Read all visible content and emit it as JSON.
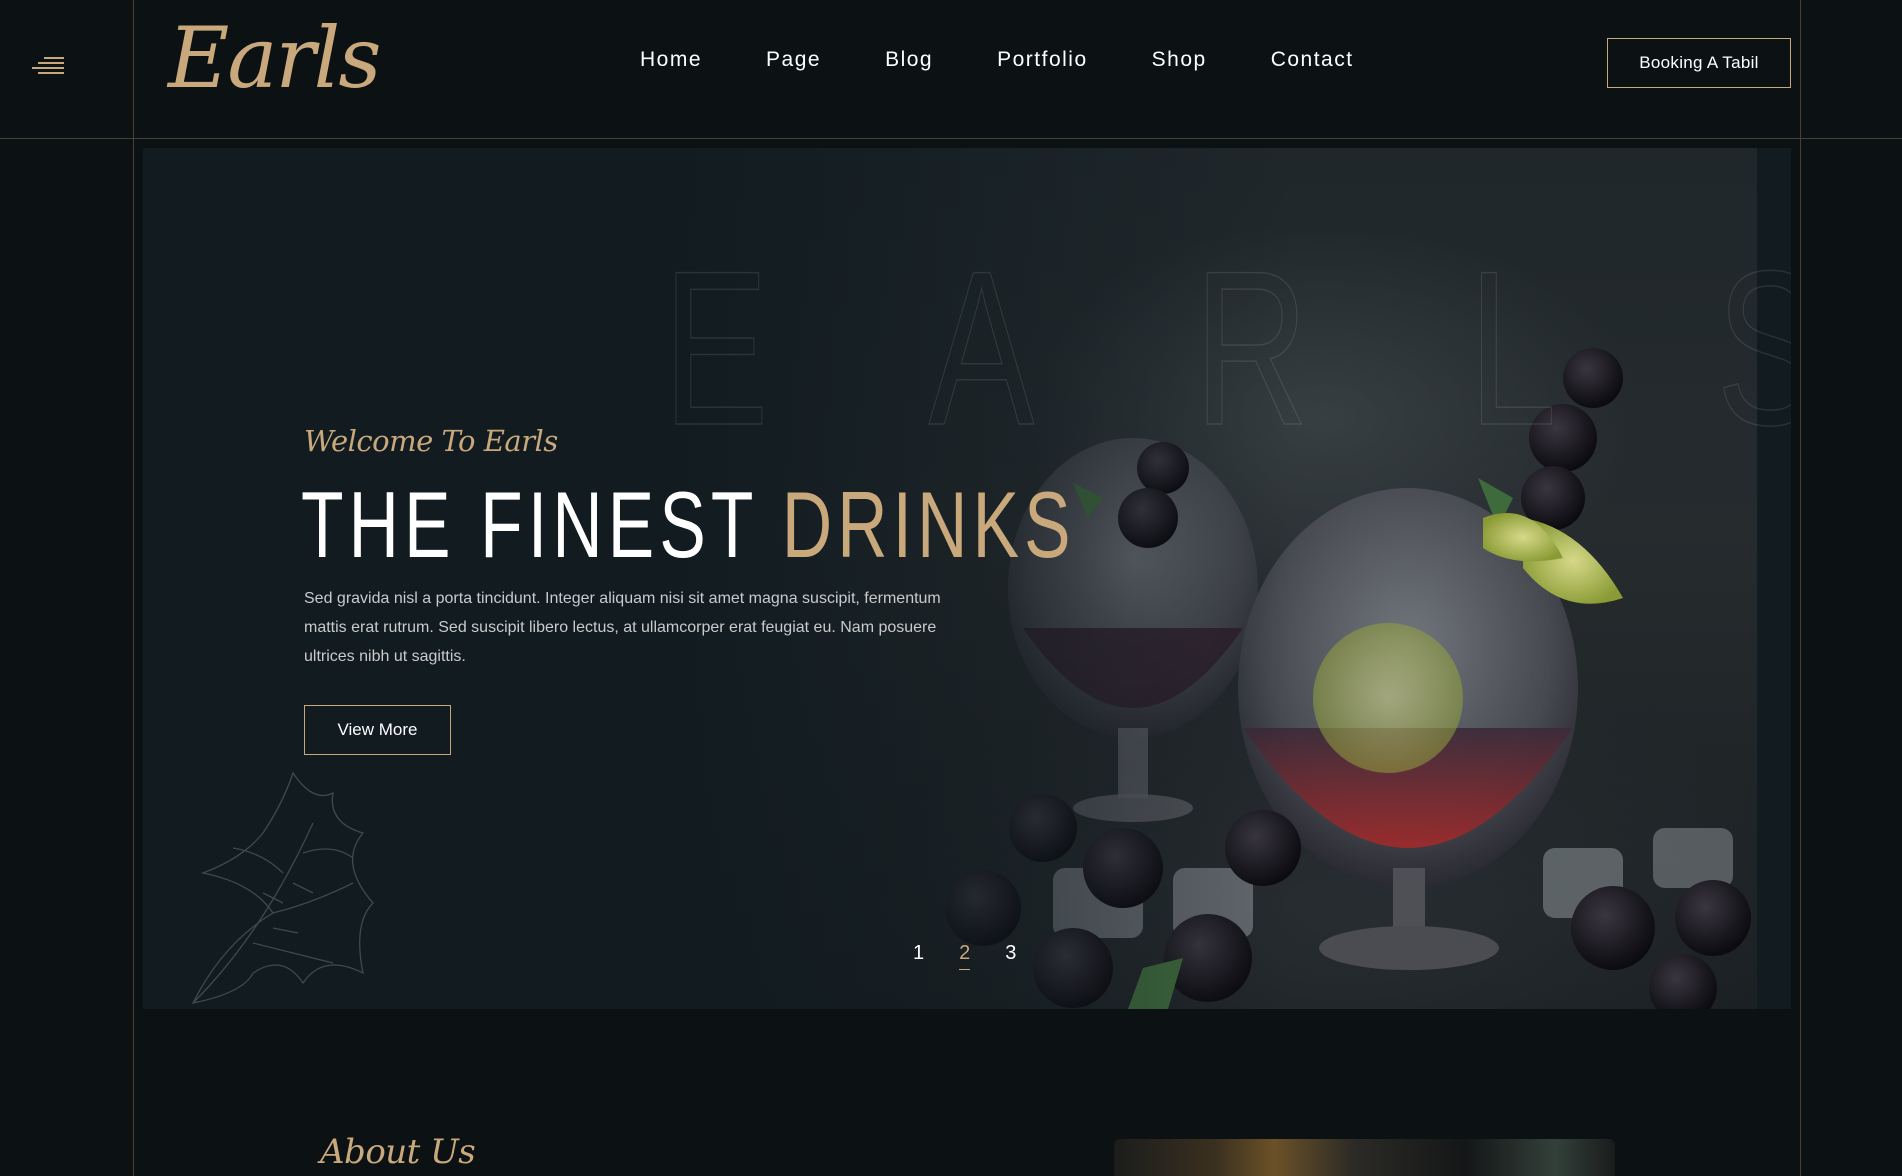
{
  "header": {
    "logo": "Earls",
    "nav": [
      "Home",
      "Page",
      "Blog",
      "Portfolio",
      "Shop",
      "Contact"
    ],
    "booking_label": "Booking A Tabil"
  },
  "hero": {
    "bg_letters": [
      "E",
      "A",
      "R",
      "L",
      "S"
    ],
    "welcome": "Welcome To Earls",
    "headline_white": "THE FINEST",
    "headline_gold": "DRINKS",
    "description": "Sed gravida nisl a porta tincidunt. Integer aliquam nisi sit amet magna suscipit, fermentum mattis erat rutrum. Sed suscipit libero lectus, at ullamcorper erat feugiat eu. Nam posuere ultrices nibh ut sagittis.",
    "view_more_label": "View More",
    "slides": [
      "1",
      "2",
      "3"
    ],
    "active_slide": "2"
  },
  "about": {
    "title": "About Us"
  },
  "colors": {
    "background": "#0c1114",
    "hero_bg": "#111b20",
    "accent_gold": "#c9a97c",
    "frame_line": "#4a3f30"
  },
  "icons": {
    "menu": "hamburger-menu-icon",
    "leaf": "leaf-sketch-icon"
  }
}
